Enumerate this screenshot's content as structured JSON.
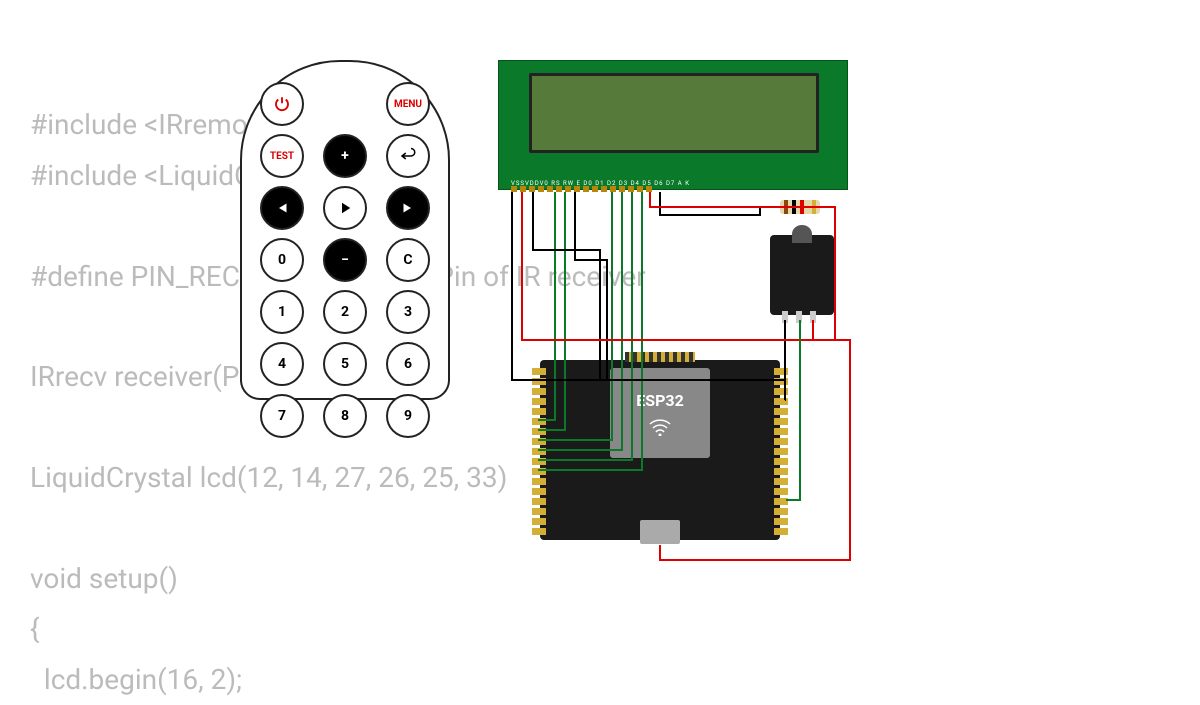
{
  "code": {
    "line1": "#include <IRremote.h>",
    "line2": "#include <LiquidCrystal.h",
    "line3": "",
    "line4": "#define PIN_RECEIVER 17",
    "line4b": "Pin of IR receiver",
    "line5": "",
    "line6": "IRrecv receiver(PIN_RECE",
    "line7": "",
    "line8": "LiquidCrystal lcd(12, 14, 27, 26, 25, 33)",
    "line9": "",
    "line10": "void setup()",
    "line11": "{",
    "line12": "  lcd.begin(16, 2);"
  },
  "remote": {
    "power": "⏻",
    "test": "TEST",
    "menu": "MENU",
    "plus": "+",
    "back": "↶",
    "prev": "⏮",
    "play": "▶",
    "next": "⏭",
    "zero": "0",
    "minus": "−",
    "c": "C",
    "n1": "1",
    "n2": "2",
    "n3": "3",
    "n4": "4",
    "n5": "5",
    "n6": "6",
    "n7": "7",
    "n8": "8",
    "n9": "9"
  },
  "lcd": {
    "pinlabels": "VSSVDDV0 RS RW E  D0 D1 D2 D3 D4 D5 D6 D7 A   K"
  },
  "esp32": {
    "label": "ESP32"
  },
  "colors": {
    "wire_green": "#0a7a2a",
    "wire_black": "#000000",
    "wire_red": "#d00000",
    "pcb": "#1a1a1a",
    "lcd_pcb": "#0a7a2a",
    "lcd_screen": "#567a3a"
  }
}
